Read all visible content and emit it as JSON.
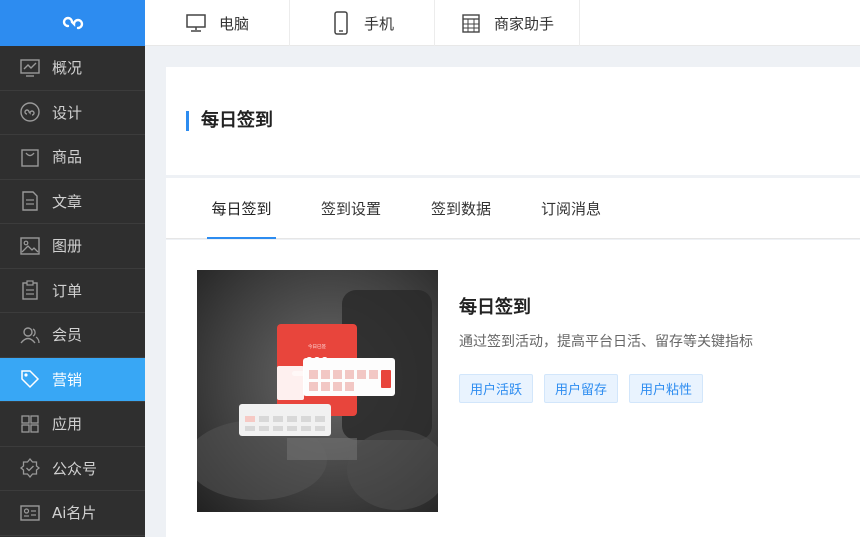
{
  "sidebar": {
    "items": [
      {
        "label": "概况",
        "icon": "chart-line-icon"
      },
      {
        "label": "设计",
        "icon": "design-icon"
      },
      {
        "label": "商品",
        "icon": "shopping-bag-icon"
      },
      {
        "label": "文章",
        "icon": "document-icon"
      },
      {
        "label": "图册",
        "icon": "image-icon"
      },
      {
        "label": "订单",
        "icon": "clipboard-icon"
      },
      {
        "label": "会员",
        "icon": "users-icon"
      },
      {
        "label": "营销",
        "icon": "tag-icon",
        "active": true
      },
      {
        "label": "应用",
        "icon": "grid-icon"
      },
      {
        "label": "公众号",
        "icon": "badge-icon"
      },
      {
        "label": "Ai名片",
        "icon": "id-card-icon"
      }
    ]
  },
  "topbar": {
    "tabs": [
      {
        "label": "电脑",
        "icon": "monitor-icon"
      },
      {
        "label": "手机",
        "icon": "phone-icon"
      },
      {
        "label": "商家助手",
        "icon": "calendar-icon"
      }
    ]
  },
  "header": {
    "title": "每日签到"
  },
  "subtabs": [
    {
      "label": "每日签到",
      "active": true
    },
    {
      "label": "签到设置"
    },
    {
      "label": "签到数据"
    },
    {
      "label": "订阅消息"
    }
  ],
  "feature": {
    "title": "每日签到",
    "description": "通过签到活动，提高平台日活、留存等关键指标",
    "tags": [
      "用户活跃",
      "用户留存",
      "用户粘性"
    ],
    "preview_number": "888"
  },
  "colors": {
    "accent": "#2d8cf0",
    "sidebar_bg": "#2f2f2f",
    "sidebar_active": "#38a7f5"
  }
}
